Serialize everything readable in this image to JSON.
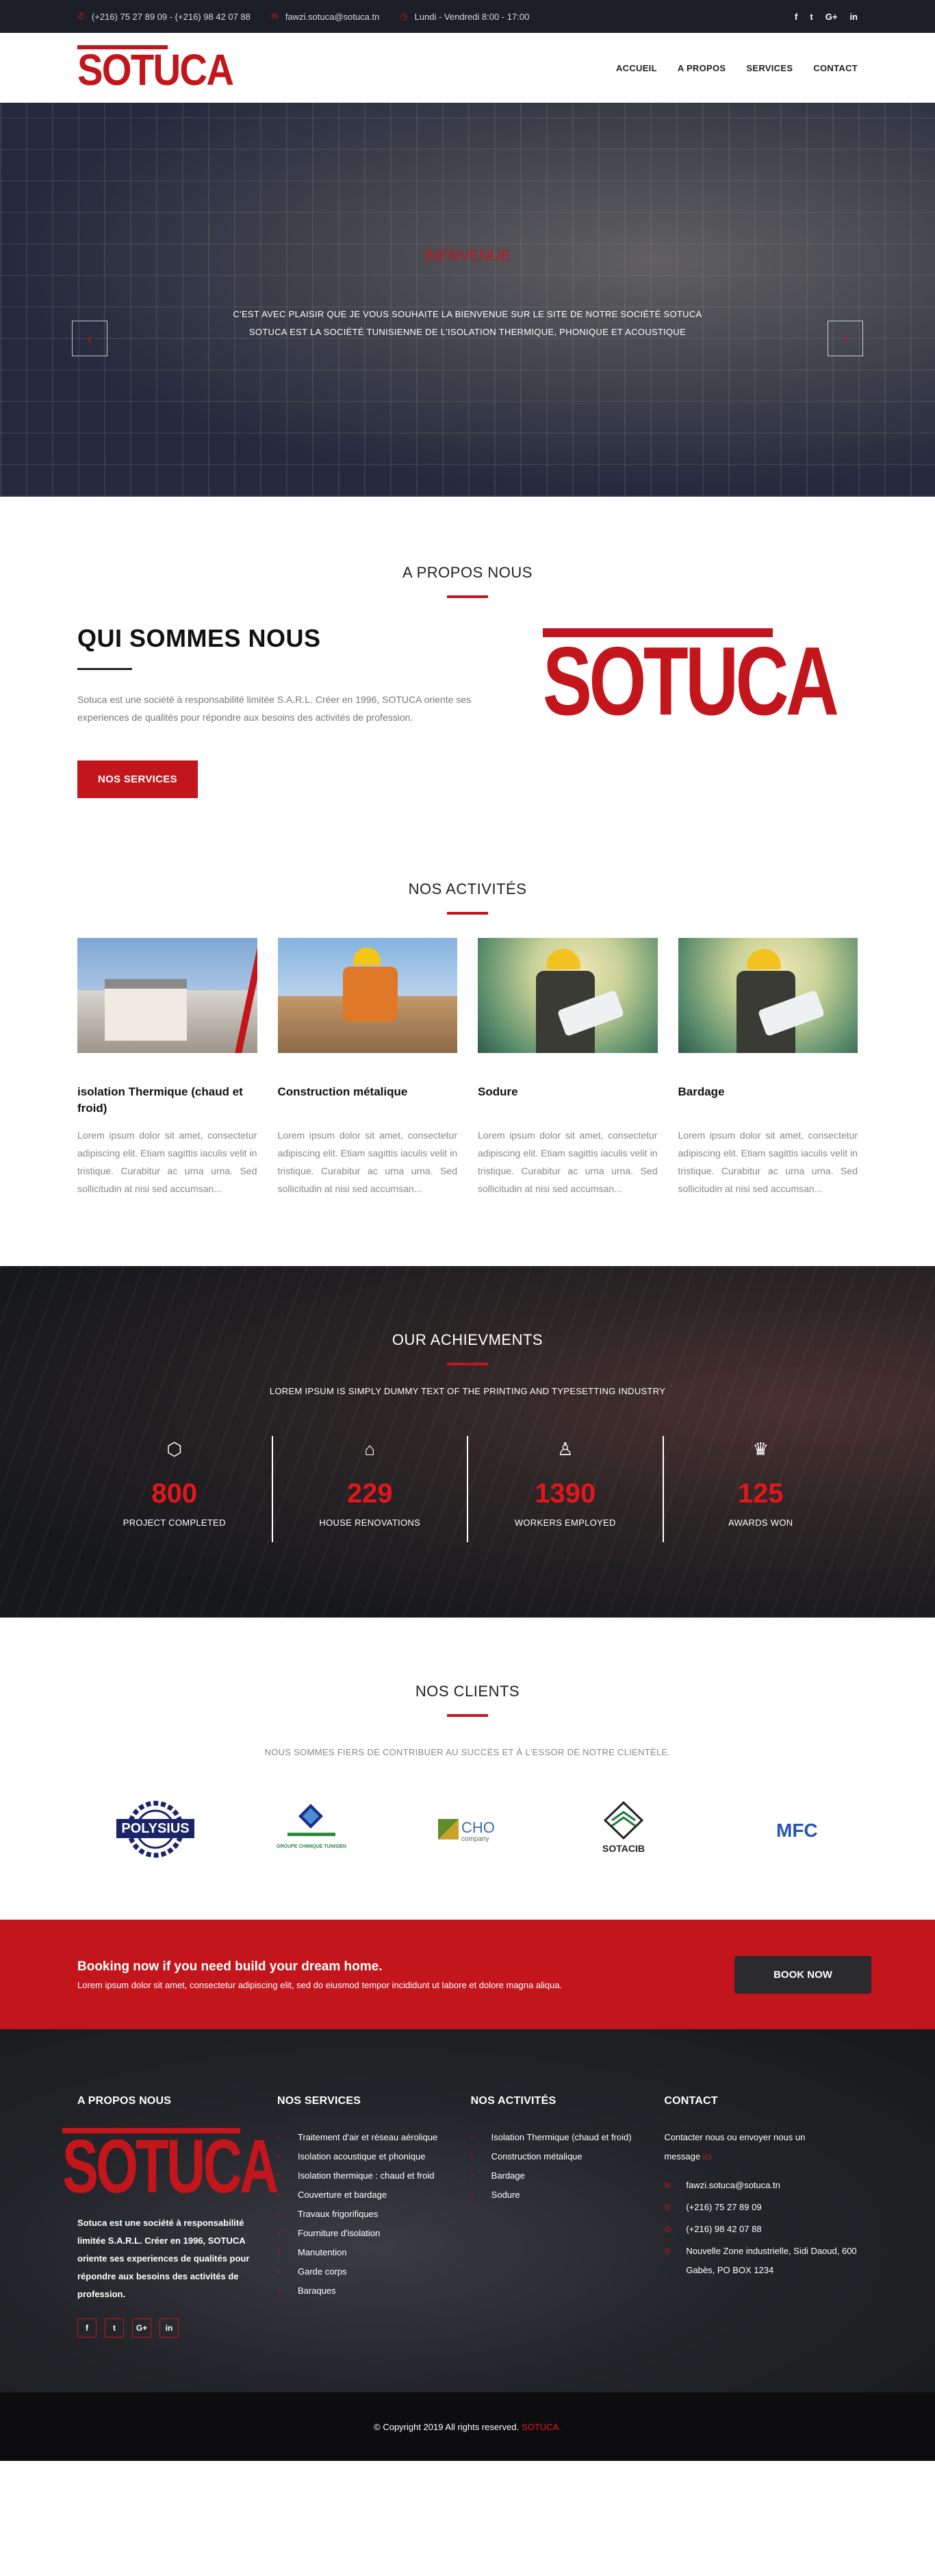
{
  "topbar": {
    "phone": "(+216) 75 27 89 09 - (+216) 98 42 07 88",
    "email": "fawzi.sotuca@sotuca.tn",
    "hours": "Lundi - Vendredi 8:00 - 17:00",
    "social": [
      "f",
      "t",
      "G+",
      "in"
    ]
  },
  "brand": {
    "name": "SOTUCA"
  },
  "nav": {
    "items": [
      "ACCUEIL",
      "A PROPOS",
      "SERVICES",
      "CONTACT"
    ]
  },
  "hero": {
    "kicker": "BIENVENUE",
    "line1": "C'EST AVEC PLAISIR QUE JE VOUS SOUHAITE LA BIENVENUE SUR LE SITE DE NOTRE SOCIÉTÉ SOTUCA",
    "line2": "SOTUCA EST LA SOCIÉTÉ TUNISIENNE DE L'ISOLATION THERMIQUE, PHONIQUE ET ACOUSTIQUE",
    "prev": "‹",
    "next": "›"
  },
  "about": {
    "section_title": "A PROPOS NOUS",
    "heading": "QUI SOMMES NOUS",
    "text": "Sotuca est une société à responsabilité limitée S.A.R.L. Créer en 1996, SOTUCA oriente ses experiences de qualités pour répondre aux besoins des activités de profession.",
    "button": "NOS SERVICES"
  },
  "activities": {
    "section_title": "NOS ACTIVITÉS",
    "items": [
      {
        "title": "isolation Thermique (chaud et froid)",
        "text": "Lorem ipsum dolor sit amet, consectetur adipiscing elit. Etiam sagittis iaculis velit in tristique. Curabitur ac urna urna. Sed sollicitudin at nisi sed accumsan..."
      },
      {
        "title": "Construction métalique",
        "text": "Lorem ipsum dolor sit amet, consectetur adipiscing elit. Etiam sagittis iaculis velit in tristique. Curabitur ac urna urna. Sed sollicitudin at nisi sed accumsan..."
      },
      {
        "title": "Sodure",
        "text": "Lorem ipsum dolor sit amet, consectetur adipiscing elit. Etiam sagittis iaculis velit in tristique. Curabitur ac urna urna. Sed sollicitudin at nisi sed accumsan..."
      },
      {
        "title": "Bardage",
        "text": "Lorem ipsum dolor sit amet, consectetur adipiscing elit. Etiam sagittis iaculis velit in tristique. Curabitur ac urna urna. Sed sollicitudin at nisi sed accumsan..."
      }
    ]
  },
  "achievements": {
    "section_title": "OUR ACHIEVMENTS",
    "subtitle": "LOREM IPSUM IS SIMPLY DUMMY TEXT OF THE PRINTING AND TYPESETTING INDUSTRY",
    "stats": [
      {
        "icon": "cube-icon",
        "value": "800",
        "label": "PROJECT COMPLETED"
      },
      {
        "icon": "home-icon",
        "value": "229",
        "label": "HOUSE RENOVATIONS"
      },
      {
        "icon": "worker-icon",
        "value": "1390",
        "label": "WORKERS EMPLOYED"
      },
      {
        "icon": "trophy-icon",
        "value": "125",
        "label": "AWARDS WON"
      }
    ]
  },
  "clients": {
    "section_title": "NOS CLIENTS",
    "subtitle": "NOUS SOMMES FIERS DE CONTRIBUER AU SUCCÈS ET À L'ESSOR DE NOTRE CLIENTÈLE.",
    "logos": [
      {
        "name": "POLYSIUS"
      },
      {
        "name": "GROUPE CHIMIQUE TUNISIEN"
      },
      {
        "name": "CHO",
        "sub": "company"
      },
      {
        "name": "SOTACIB"
      },
      {
        "name": "MFC"
      }
    ]
  },
  "cta": {
    "heading": "Booking now if you need build your dream home.",
    "text": "Lorem ipsum dolor sit amet, consectetur adipiscing elit, sed do eiusmod tempor incididunt ut labore et dolore magna aliqua.",
    "button": "BOOK NOW"
  },
  "footer": {
    "about_title": "A PROPOS NOUS",
    "about_text": "Sotuca est une société à responsabilité limitée S.A.R.L. Créer en 1996, SOTUCA oriente ses experiences de qualités pour répondre aux besoins des activités de profession.",
    "social": [
      "f",
      "t",
      "G+",
      "in"
    ],
    "services_title": "NOS SERVICES",
    "services": [
      "Traitement d'air et réseau aérolique",
      "Isolation acoustique et phonique",
      "Isolation thermique : chaud et froid",
      "Couverture et bardage",
      "Travaux frigorifiques",
      "Fourniture d'isolation",
      "Manutention",
      "Garde corps",
      "Baraques"
    ],
    "activities_title": "NOS ACTIVITÉS",
    "activities": [
      "Isolation Thermique (chaud et froid)",
      "Construction métalique",
      "Bardage",
      "Sodure"
    ],
    "contact_title": "CONTACT",
    "contact_intro": "Contacter nous ou envoyer nous un message",
    "contact_link": "ici",
    "email": "fawzi.sotuca@sotuca.tn",
    "phone1": "(+216) 75 27 89 09",
    "phone2": "(+216) 98 42 07 88",
    "address": "Nouvelle Zone industrielle, Sidi Daoud, 600 Gabès, PO BOX 1234"
  },
  "copyright": {
    "text": "© Copyright 2019 All rights reserved.",
    "brand": "SOTUCA."
  },
  "colors": {
    "accent": "#c3161c",
    "dark": "#1c1f28",
    "cta_bg": "#c3161c"
  }
}
